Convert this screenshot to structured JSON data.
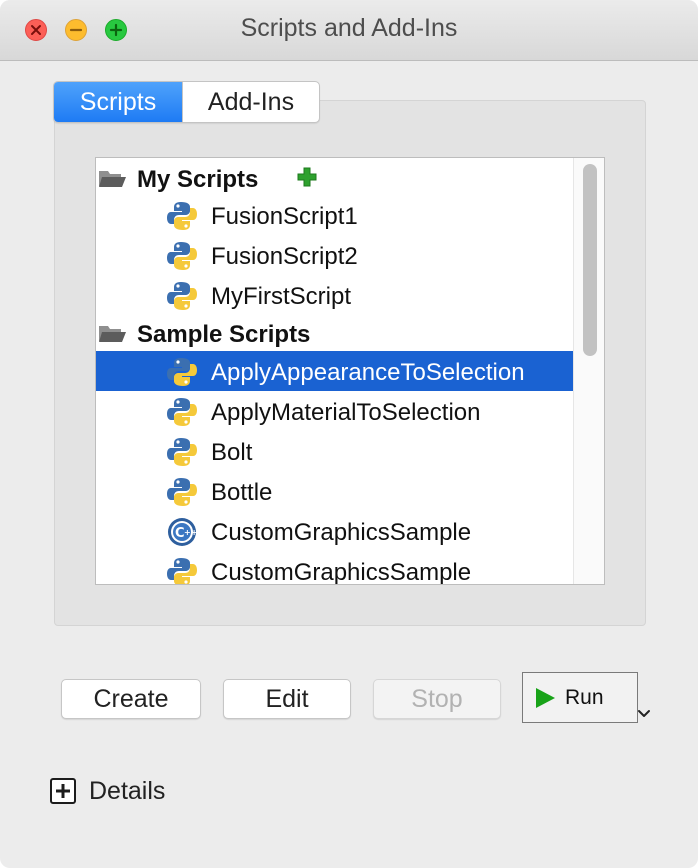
{
  "window": {
    "title": "Scripts and Add-Ins"
  },
  "tabs": [
    {
      "label": "Scripts",
      "active": true
    },
    {
      "label": "Add-Ins",
      "active": false
    }
  ],
  "tree": {
    "rows": [
      {
        "type": "folder",
        "label": "My Scripts",
        "icon": "folder-icon",
        "action_icon": "add-icon"
      },
      {
        "type": "item",
        "label": "FusionScript1",
        "icon": "python-icon"
      },
      {
        "type": "item",
        "label": "FusionScript2",
        "icon": "python-icon"
      },
      {
        "type": "item",
        "label": "MyFirstScript",
        "icon": "python-icon"
      },
      {
        "type": "folder",
        "label": "Sample Scripts",
        "icon": "folder-icon"
      },
      {
        "type": "item",
        "label": "ApplyAppearanceToSelection",
        "icon": "python-icon",
        "selected": true
      },
      {
        "type": "item",
        "label": "ApplyMaterialToSelection",
        "icon": "python-icon"
      },
      {
        "type": "item",
        "label": "Bolt",
        "icon": "python-icon"
      },
      {
        "type": "item",
        "label": "Bottle",
        "icon": "python-icon"
      },
      {
        "type": "item",
        "label": "CustomGraphicsSample",
        "icon": "cpp-icon"
      },
      {
        "type": "item",
        "label": "CustomGraphicsSample",
        "icon": "python-icon"
      }
    ]
  },
  "buttons": {
    "create": "Create",
    "edit": "Edit",
    "stop": "Stop",
    "run": "Run"
  },
  "details": {
    "label": "Details"
  },
  "colors": {
    "selection": "#1a62d2",
    "tab_active": "#2a86f7",
    "add_icon": "#2ea12e",
    "run_icon": "#19a319"
  }
}
